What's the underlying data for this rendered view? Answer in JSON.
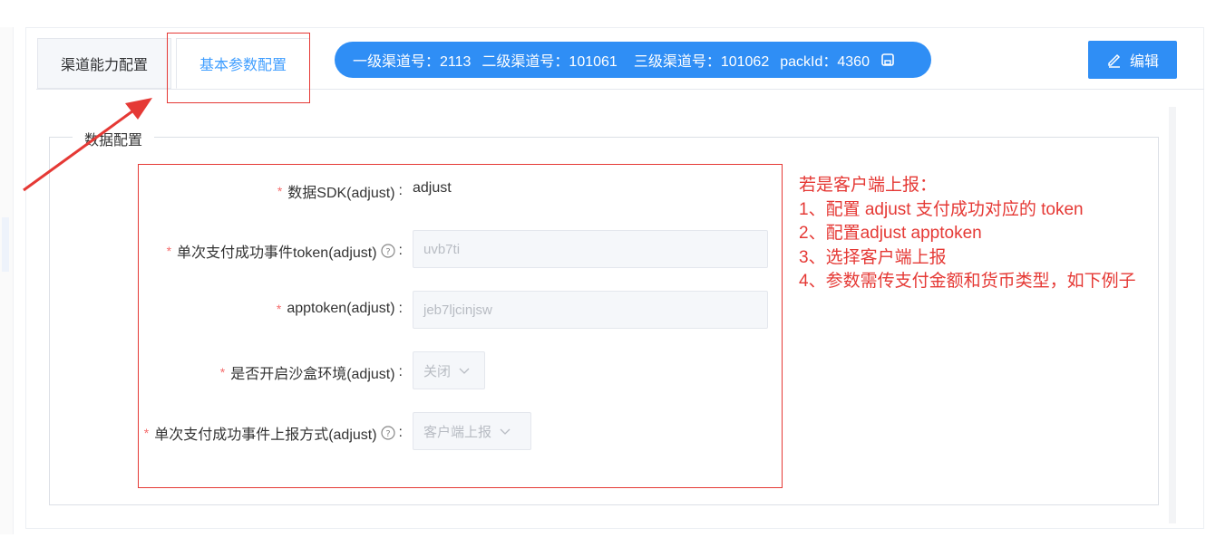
{
  "tabs": [
    {
      "label": "渠道能力配置",
      "active": false
    },
    {
      "label": "基本参数配置",
      "active": true
    }
  ],
  "channel_info": {
    "level1": "一级渠道号：2113",
    "level2": "二级渠道号：101061",
    "level3": "三级渠道号：101062",
    "pack": "packId：4360",
    "icon": "save-icon"
  },
  "edit_button": {
    "label": "编辑",
    "icon": "pencil-icon"
  },
  "section": {
    "legend": "数据配置"
  },
  "form": {
    "sdk": {
      "label": "数据SDK(adjust)",
      "value": "adjust"
    },
    "token": {
      "label": "单次支付成功事件token(adjust)",
      "value": "uvb7ti"
    },
    "apptoken": {
      "label": "apptoken(adjust)",
      "value": "jeb7ljcinjsw"
    },
    "sandbox": {
      "label": "是否开启沙盒环境(adjust)",
      "value": "关闭"
    },
    "report_mode": {
      "label": "单次支付成功事件上报方式(adjust)",
      "value": "客户端上报"
    },
    "required_mark": "*",
    "colon": ":"
  },
  "note": {
    "lines": [
      "若是客户端上报：",
      "1、配置 adjust 支付成功对应的 token",
      "2、配置adjust apptoken",
      "3、选择客户端上报",
      "4、参数需传支付金额和货币类型，如下例子"
    ]
  },
  "colors": {
    "accent": "#2f8ef5",
    "annotation": "#e53935",
    "required": "#f56c6c"
  }
}
